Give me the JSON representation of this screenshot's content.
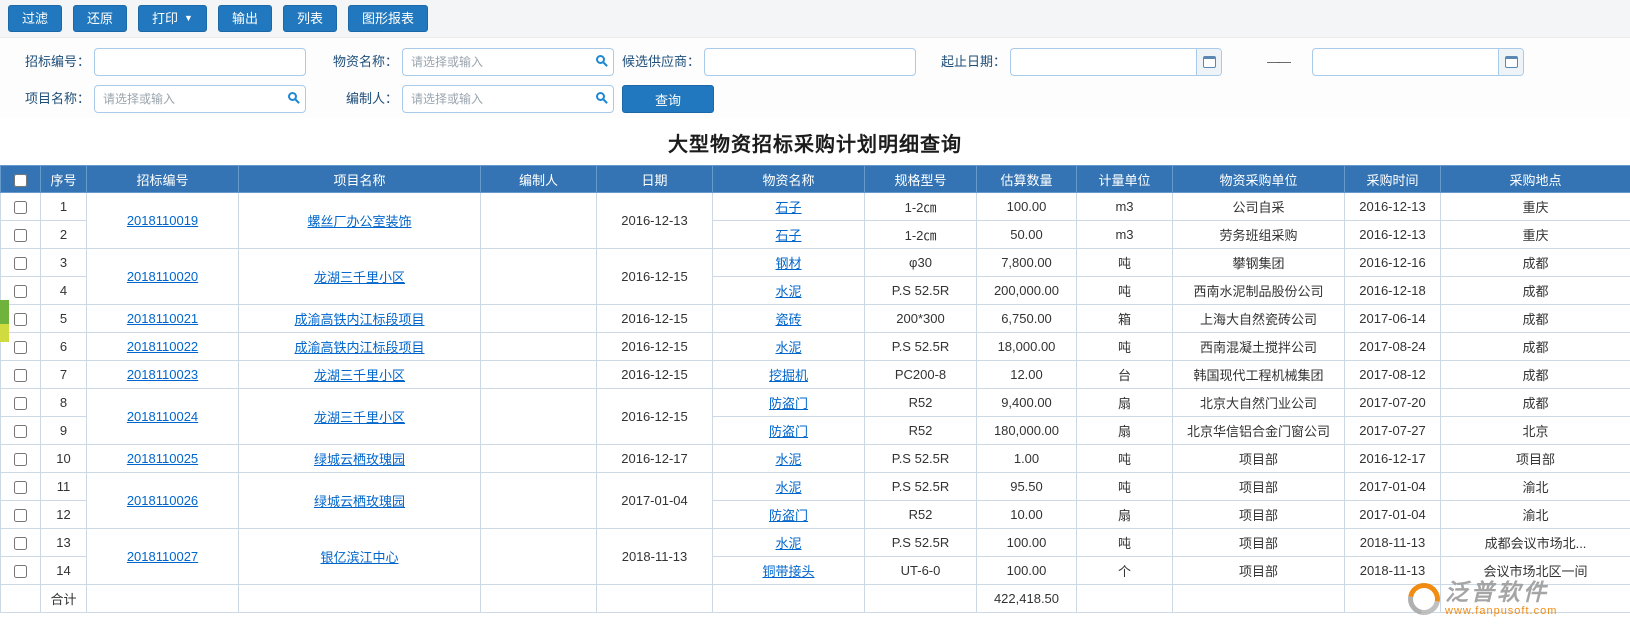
{
  "toolbar": {
    "buttons": [
      "过滤",
      "还原",
      "打印",
      "输出",
      "列表",
      "图形报表"
    ],
    "print_caret": "▼"
  },
  "filters": {
    "bid_no_label": "招标编号：",
    "material_label": "物资名称：",
    "material_placeholder": "请选择或输入",
    "supplier_label": "候选供应商：",
    "date_label": "起止日期：",
    "date_separator": "——",
    "project_label": "项目名称：",
    "project_placeholder": "请选择或输入",
    "compiler_label": "编制人：",
    "compiler_placeholder": "请选择或输入",
    "search_button": "查询"
  },
  "page_title": "大型物资招标采购计划明细查询",
  "table": {
    "columns": [
      "序号",
      "招标编号",
      "项目名称",
      "编制人",
      "日期",
      "物资名称",
      "规格型号",
      "估算数量",
      "计量单位",
      "物资采购单位",
      "采购时间",
      "采购地点"
    ],
    "groups": [
      {
        "bid_no": "2018110019",
        "project": "螺丝厂办公室装饰",
        "compiler": "",
        "date": "2016-12-13",
        "items": [
          {
            "material": "石子",
            "spec": "1-2㎝",
            "qty": "100.00",
            "unit": "m3",
            "purchaser": "公司自采",
            "time": "2016-12-13",
            "place": "重庆"
          },
          {
            "material": "石子",
            "spec": "1-2㎝",
            "qty": "50.00",
            "unit": "m3",
            "purchaser": "劳务班组采购",
            "time": "2016-12-13",
            "place": "重庆"
          }
        ]
      },
      {
        "bid_no": "2018110020",
        "project": "龙湖三千里小区",
        "compiler": "",
        "date": "2016-12-15",
        "items": [
          {
            "material": "钢材",
            "spec": "φ30",
            "qty": "7,800.00",
            "unit": "吨",
            "purchaser": "攀钢集团",
            "time": "2016-12-16",
            "place": "成都"
          },
          {
            "material": "水泥",
            "spec": "P.S 52.5R",
            "qty": "200,000.00",
            "unit": "吨",
            "purchaser": "西南水泥制品股份公司",
            "time": "2016-12-18",
            "place": "成都"
          }
        ]
      },
      {
        "bid_no": "2018110021",
        "project": "成渝高铁内江标段项目",
        "compiler": "",
        "date": "2016-12-15",
        "items": [
          {
            "material": "瓷砖",
            "spec": "200*300",
            "qty": "6,750.00",
            "unit": "箱",
            "purchaser": "上海大自然瓷砖公司",
            "time": "2017-06-14",
            "place": "成都"
          }
        ]
      },
      {
        "bid_no": "2018110022",
        "project": "成渝高铁内江标段项目",
        "compiler": "",
        "date": "2016-12-15",
        "items": [
          {
            "material": "水泥",
            "spec": "P.S 52.5R",
            "qty": "18,000.00",
            "unit": "吨",
            "purchaser": "西南混凝土搅拌公司",
            "time": "2017-08-24",
            "place": "成都"
          }
        ]
      },
      {
        "bid_no": "2018110023",
        "project": "龙湖三千里小区",
        "compiler": "",
        "date": "2016-12-15",
        "items": [
          {
            "material": "挖掘机",
            "spec": "PC200-8",
            "qty": "12.00",
            "unit": "台",
            "purchaser": "韩国现代工程机械集团",
            "time": "2017-08-12",
            "place": "成都"
          }
        ]
      },
      {
        "bid_no": "2018110024",
        "project": "龙湖三千里小区",
        "compiler": "",
        "date": "2016-12-15",
        "items": [
          {
            "material": "防盗门",
            "spec": "R52",
            "qty": "9,400.00",
            "unit": "扇",
            "purchaser": "北京大自然门业公司",
            "time": "2017-07-20",
            "place": "成都"
          },
          {
            "material": "防盗门",
            "spec": "R52",
            "qty": "180,000.00",
            "unit": "扇",
            "purchaser": "北京华信铝合金门窗公司",
            "time": "2017-07-27",
            "place": "北京"
          }
        ]
      },
      {
        "bid_no": "2018110025",
        "project": "绿城云栖玫瑰园",
        "compiler": "",
        "date": "2016-12-17",
        "items": [
          {
            "material": "水泥",
            "spec": "P.S 52.5R",
            "qty": "1.00",
            "unit": "吨",
            "purchaser": "项目部",
            "time": "2016-12-17",
            "place": "项目部"
          }
        ]
      },
      {
        "bid_no": "2018110026",
        "project": "绿城云栖玫瑰园",
        "compiler": "",
        "date": "2017-01-04",
        "items": [
          {
            "material": "水泥",
            "spec": "P.S 52.5R",
            "qty": "95.50",
            "unit": "吨",
            "purchaser": "项目部",
            "time": "2017-01-04",
            "place": "渝北"
          },
          {
            "material": "防盗门",
            "spec": "R52",
            "qty": "10.00",
            "unit": "扇",
            "purchaser": "项目部",
            "time": "2017-01-04",
            "place": "渝北"
          }
        ]
      },
      {
        "bid_no": "2018110027",
        "project": "银亿滨江中心",
        "compiler": "",
        "date": "2018-11-13",
        "items": [
          {
            "material": "水泥",
            "spec": "P.S 52.5R",
            "qty": "100.00",
            "unit": "吨",
            "purchaser": "项目部",
            "time": "2018-11-13",
            "place": "成都会议市场北..."
          },
          {
            "material": "铜带接头",
            "spec": "UT-6-0",
            "qty": "100.00",
            "unit": "个",
            "purchaser": "项目部",
            "time": "2018-11-13",
            "place": "会议市场北区一间"
          }
        ]
      }
    ],
    "footer": {
      "label": "合计",
      "total_quantity": "422,418.50"
    }
  },
  "watermark": {
    "name": "泛普软件",
    "url": "www.fanpusoft.com"
  }
}
